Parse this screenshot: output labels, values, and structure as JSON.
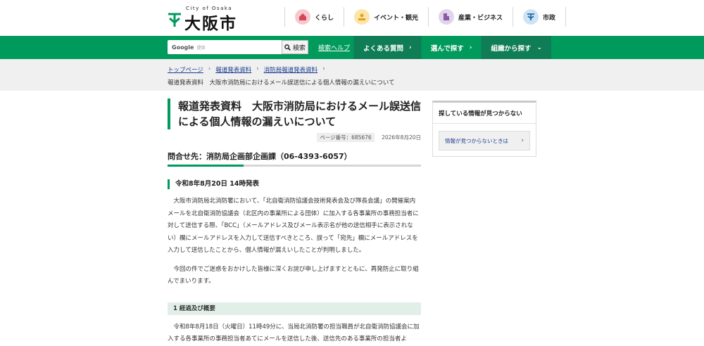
{
  "header": {
    "logo_sub": "City of Osaka",
    "logo_text": "大阪市",
    "topnav": [
      {
        "label": "くらし",
        "icon": "house-icon",
        "color": "#f6c9cf"
      },
      {
        "label": "イベント・観光",
        "icon": "event-icon",
        "color": "#fbe5a8"
      },
      {
        "label": "産業・ビジネス",
        "icon": "building-icon",
        "color": "#e2d4ea"
      },
      {
        "label": "市政",
        "icon": "city-mark-icon",
        "color": "#cfe3f2"
      }
    ]
  },
  "nav": {
    "search_brand": "Google",
    "search_brand_sub": "提供",
    "search_button": "検索",
    "search_help": "検索ヘルプ",
    "items": [
      {
        "label": "よくある質問"
      },
      {
        "label": "選んで探す"
      },
      {
        "label": "組織から探す"
      }
    ]
  },
  "breadcrumb": {
    "links": [
      "トップページ",
      "報道発表資料",
      "消防局報道発表資料"
    ],
    "current": "報道発表資料　大阪市消防局におけるメール誤送信による個人情報の漏えいについて"
  },
  "article": {
    "title": "報道発表資料　大阪市消防局におけるメール誤送信による個人情報の漏えいについて",
    "page_id": "ページ番号：685676",
    "date": "2026年8月20日",
    "contact": "問合せ先：消防局企画部企画課（06-4393-6057）",
    "release_heading": "令和8年8月20日 14時発表",
    "para1": "大阪市消防局北消防署において、「北自衛消防協議会技術発表会及び隊長会議」の開催案内メールを北自衛消防協議会（北区内の事業所による団体）に加入する各事業所の事務担当者に対して送信する際、「BCC」（メールアドレス及びメール表示名が他の送信相手に表示されない）欄にメールアドレスを入力して送信すべきところ、誤って「宛先」欄にメールアドレスを入力して送信したことから、個人情報が漏えいしたことが判明しました。",
    "para2": "今回の件でご迷惑をおかけした皆様に深くお詫び申し上げますとともに、再発防止に取り組んでまいります。",
    "sub_heading": "1 経過及び概要",
    "para3": "令和8年8月18日（火曜日）11時49分に、当局北消防署の担当職員が北自衛消防協議会に加入する各事業所の事務担当者あてにメールを送信した後、送信先のある事業所の担当者よ"
  },
  "side": {
    "title": "探している情報が見つからない",
    "link": "情報が見つからないときは"
  }
}
